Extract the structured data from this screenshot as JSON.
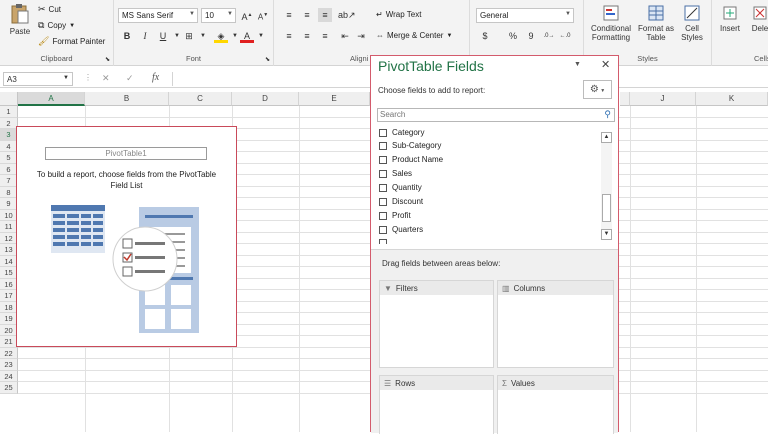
{
  "ribbon": {
    "clipboard": {
      "paste": "Paste",
      "cut": "Cut",
      "copy": "Copy",
      "format_painter": "Format Painter",
      "label": "Clipboard"
    },
    "font": {
      "name": "MS Sans Serif",
      "size": "10",
      "bold": "B",
      "italic": "I",
      "underline": "U",
      "label": "Font"
    },
    "alignment": {
      "wrap": "Wrap Text",
      "merge": "Merge & Center",
      "label": "Aligni"
    },
    "number": {
      "format": "General",
      "percent": "%",
      "comma": "9"
    },
    "styles": {
      "conditional_1": "Conditional",
      "conditional_2": "Formatting",
      "format_as_1": "Format as",
      "format_as_2": "Table",
      "cell_1": "Cell",
      "cell_2": "Styles",
      "label": "Styles"
    },
    "cells": {
      "insert": "Insert",
      "delete": "Dele",
      "label": "Cells"
    }
  },
  "formula_bar": {
    "name_box": "A3",
    "cancel": "✕",
    "enter": "✓",
    "fx": "fx"
  },
  "columns": [
    "A",
    "B",
    "C",
    "D",
    "E",
    "J",
    "K"
  ],
  "rows": [
    "1",
    "2",
    "3",
    "4",
    "5",
    "6",
    "7",
    "8",
    "9",
    "10",
    "11",
    "12",
    "13",
    "14",
    "15",
    "16",
    "17",
    "18",
    "19",
    "20",
    "21",
    "22",
    "23",
    "24",
    "25"
  ],
  "pivot_placeholder": {
    "name": "PivotTable1",
    "instruction_1": "To build a report, choose fields from the PivotTable",
    "instruction_2": "Field List"
  },
  "pane": {
    "title": "PivotTable Fields",
    "subtitle": "Choose fields to add to report:",
    "search_placeholder": "Search",
    "fields": [
      "Category",
      "Sub-Category",
      "Product Name",
      "Sales",
      "Quantity",
      "Discount",
      "Profit",
      "Quarters"
    ],
    "drag_text": "Drag fields between areas below:",
    "areas": {
      "filters": "Filters",
      "columns": "Columns",
      "rows": "Rows",
      "values": "Values"
    }
  },
  "colors": {
    "accent_green": "#217346",
    "highlight_red": "#d35b6c",
    "illus_blue": "#5b7fb5"
  }
}
